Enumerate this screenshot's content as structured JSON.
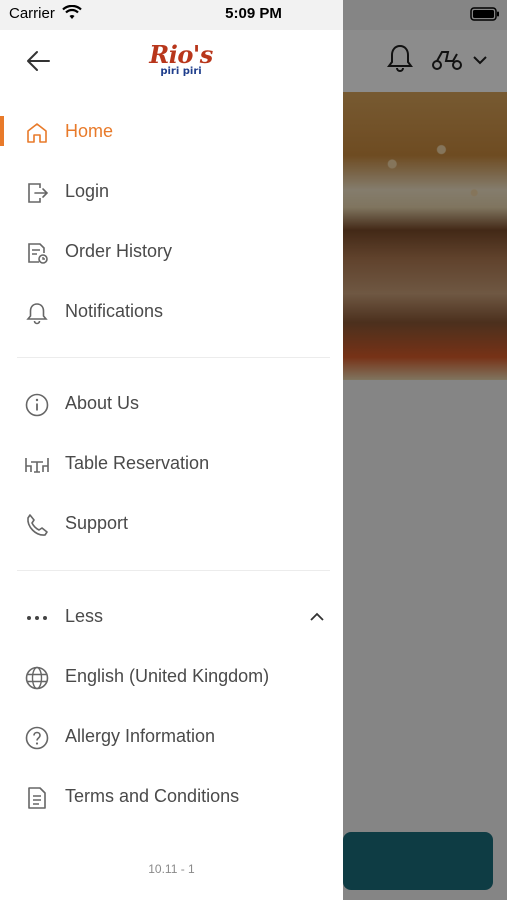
{
  "status_bar": {
    "carrier": "Carrier",
    "time": "5:09 PM"
  },
  "logo": {
    "main": "Rio's",
    "sub": "piri piri"
  },
  "menu": {
    "items": [
      {
        "label": "Home",
        "icon": "home-icon",
        "active": true
      },
      {
        "label": "Login",
        "icon": "login-icon"
      },
      {
        "label": "Order History",
        "icon": "order-history-icon"
      },
      {
        "label": "Notifications",
        "icon": "bell-icon"
      },
      {
        "label": "About Us",
        "icon": "info-icon"
      },
      {
        "label": "Table Reservation",
        "icon": "table-icon"
      },
      {
        "label": "Support",
        "icon": "phone-icon"
      },
      {
        "label": "Less",
        "icon": "more-dots-icon"
      },
      {
        "label": "English (United Kingdom)",
        "icon": "globe-icon"
      },
      {
        "label": "Allergy Information",
        "icon": "question-icon"
      },
      {
        "label": "Terms and Conditions",
        "icon": "document-icon"
      }
    ]
  },
  "version": "10.11 - 1",
  "colors": {
    "accent": "#e87a2a",
    "text": "#4a4a4a",
    "cta": "#1b6d7d"
  }
}
